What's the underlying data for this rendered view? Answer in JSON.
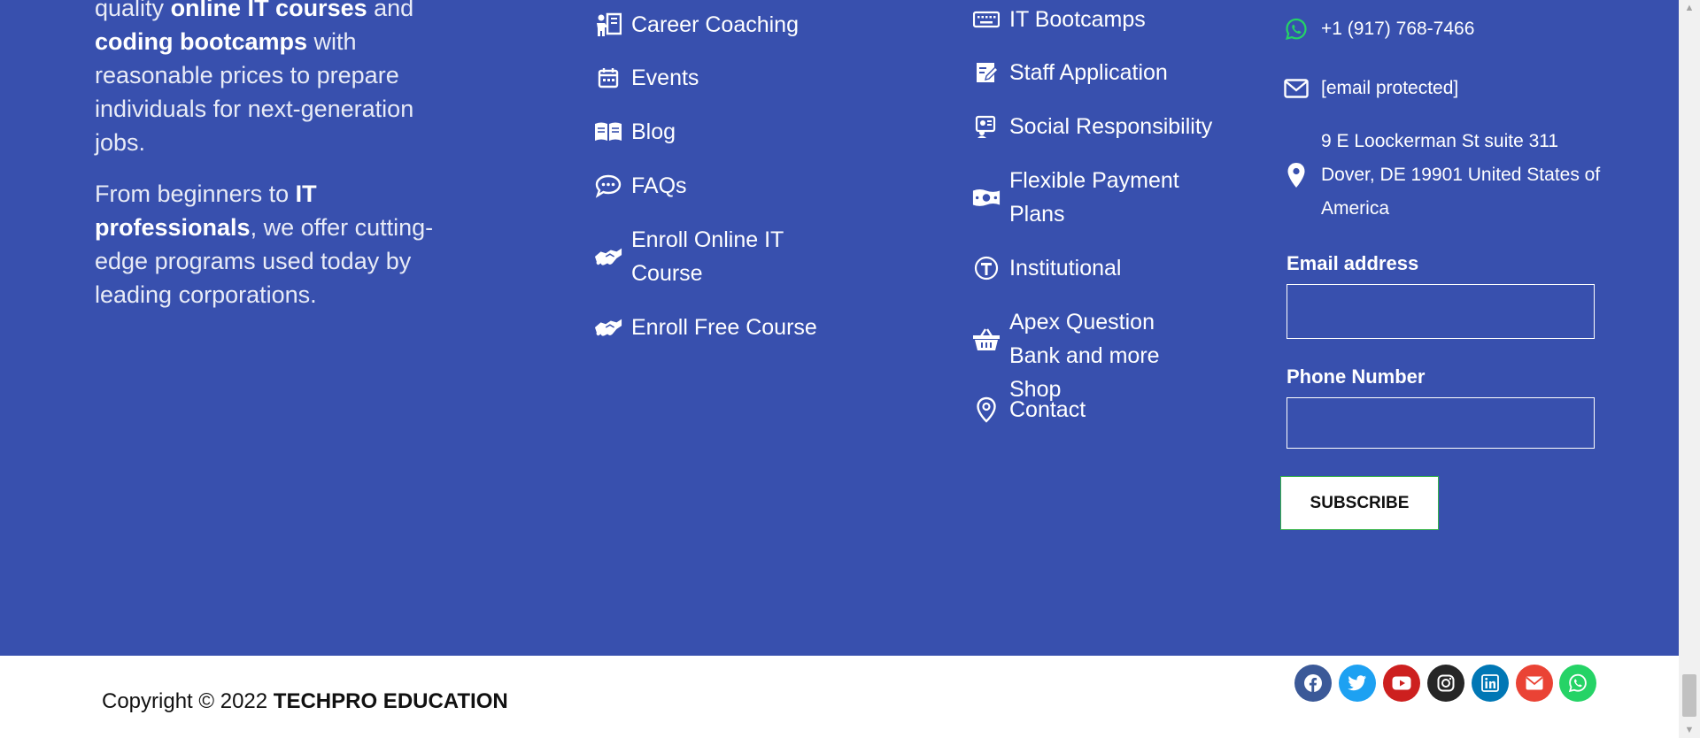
{
  "about": {
    "p1_pre": "quality ",
    "p1_bold1": "online IT courses",
    "p1_mid": " and ",
    "p1_bold2": "coding bootcamps",
    "p1_post": "  with reasonable prices to prepare individuals for next-generation jobs.",
    "p2_pre": "From beginners to ",
    "p2_bold": "IT professionals",
    "p2_post": ", we offer cutting-edge programs used today by leading corporations."
  },
  "nav_col1": [
    {
      "label": "Career Coaching",
      "icon": "career-coaching-icon"
    },
    {
      "label": "Events",
      "icon": "calendar-icon"
    },
    {
      "label": "Blog",
      "icon": "book-open-icon"
    },
    {
      "label": "FAQs",
      "icon": "chat-bubble-icon"
    },
    {
      "label": "Enroll Online IT Course",
      "icon": "handshake-icon"
    },
    {
      "label": "Enroll Free Course",
      "icon": "handshake-icon"
    }
  ],
  "nav_col2": [
    {
      "label": "IT Bootcamps",
      "icon": "keyboard-icon"
    },
    {
      "label": "Staff Application",
      "icon": "edit-document-icon"
    },
    {
      "label": "Social Responsibility",
      "icon": "person-badge-icon"
    },
    {
      "label": "Flexible Payment Plans",
      "icon": "money-bill-icon"
    },
    {
      "label": "Institutional",
      "icon": "institution-icon"
    },
    {
      "label": "Apex Question Bank and more Shop",
      "icon": "shopping-basket-icon"
    },
    {
      "label": "Contact",
      "icon": "map-pin-icon"
    }
  ],
  "contact": {
    "phone": "+1 (917) 768-7466",
    "email": "[email protected]",
    "address": "9 E Loockerman St suite 311 Dover, DE 19901 United States of America"
  },
  "form": {
    "email_label": "Email address",
    "phone_label": "Phone Number",
    "email_value": "",
    "phone_value": "",
    "subscribe_label": "SUBSCRIBE"
  },
  "copyright": {
    "prefix": "Copyright © 2022 ",
    "brand": "TECHPRO EDUCATION"
  },
  "social": [
    {
      "name": "facebook-icon",
      "color": "#3b5998"
    },
    {
      "name": "twitter-icon",
      "color": "#1da1f2"
    },
    {
      "name": "youtube-icon",
      "color": "#cd201f"
    },
    {
      "name": "instagram-icon",
      "color": "#262626"
    },
    {
      "name": "linkedin-icon",
      "color": "#0077b5"
    },
    {
      "name": "envelope-icon",
      "color": "#ea4335"
    },
    {
      "name": "whatsapp-icon",
      "color": "#25d366"
    }
  ],
  "colors": {
    "footer_bg": "#3850ae",
    "whatsapp_green": "#25d366",
    "subscribe_border": "#37b34a"
  }
}
